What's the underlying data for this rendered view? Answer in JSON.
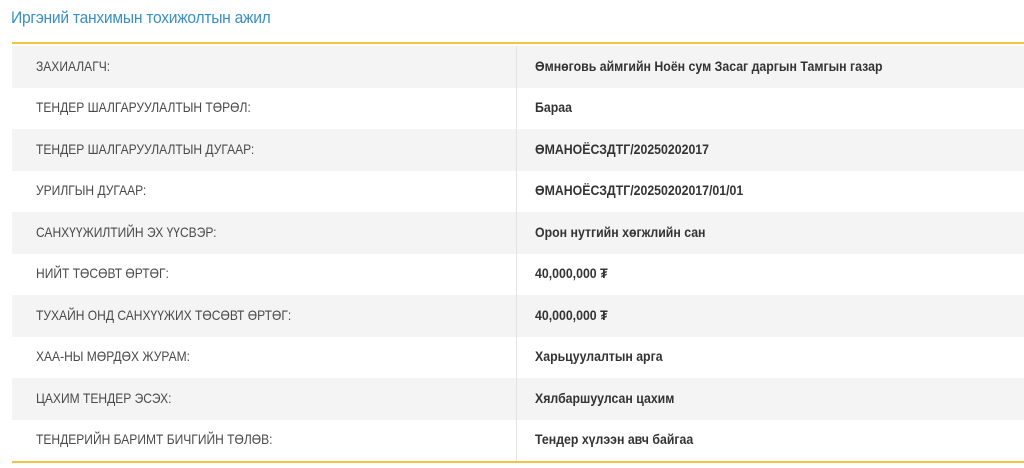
{
  "section": {
    "title": "Иргэний танхимын тохижолтын ажил"
  },
  "rows": [
    {
      "label": "ЗАХИАЛАГЧ:",
      "value": "Өмнөговь аймгийн Ноён сум Засаг даргын Тамгын газар"
    },
    {
      "label": "ТЕНДЕР ШАЛГАРУУЛАЛТЫН ТӨРӨЛ:",
      "value": "Бараа"
    },
    {
      "label": "ТЕНДЕР ШАЛГАРУУЛАЛТЫН ДУГААР:",
      "value": "ӨМАНОЁСЗДТГ/20250202017"
    },
    {
      "label": "УРИЛГЫН ДУГААР:",
      "value": "ӨМАНОЁСЗДТГ/20250202017/01/01"
    },
    {
      "label": "САНХҮҮЖИЛТИЙН ЭХ ҮҮСВЭР:",
      "value": "Орон нутгийн хөгжлийн сан"
    },
    {
      "label": "НИЙТ ТӨСӨВТ ӨРТӨГ:",
      "value": "40,000,000 ₮"
    },
    {
      "label": "ТУХАЙН ОНД САНХҮҮЖИХ ТӨСӨВТ ӨРТӨГ:",
      "value": "40,000,000 ₮"
    },
    {
      "label": "ХАА-НЫ МӨРДӨХ ЖУРАМ:",
      "value": "Харьцуулалтын арга"
    },
    {
      "label": "ЦАХИМ ТЕНДЕР ЭСЭХ:",
      "value": "Хялбаршуулсан цахим"
    },
    {
      "label": "ТЕНДЕРИЙН БАРИМТ БИЧГИЙН ТӨЛӨВ:",
      "value": "Тендер хүлээн авч байгаа"
    }
  ],
  "colors": {
    "title": "#3a8fc4",
    "accent_rule": "#f5c242",
    "row_stripe": "#f4f4f4",
    "label_text": "#4a4a4a",
    "value_text": "#333333"
  }
}
